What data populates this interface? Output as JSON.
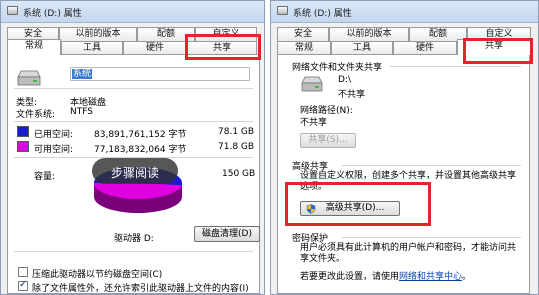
{
  "left_window": {
    "title": "系统 (D:) 属性",
    "tabs_row1": [
      "安全",
      "以前的版本",
      "配额",
      "自定义"
    ],
    "tabs_row2": [
      "常规",
      "工具",
      "硬件",
      "共享"
    ],
    "volume_label": "系统",
    "type_label": "类型:",
    "type_value": "本地磁盘",
    "fs_label": "文件系统:",
    "fs_value": "NTFS",
    "used_label": "已用空间:",
    "used_bytes": "83,891,761,152 字节",
    "used_gb": "78.1 GB",
    "free_label": "可用空间:",
    "free_bytes": "77,183,832,064 字节",
    "free_gb": "71.8 GB",
    "capacity_label": "容量:",
    "capacity_gb": "150 GB",
    "drive_label": "驱动器 D:",
    "disk_cleanup_button": "磁盘清理(D)",
    "compress_checkbox": "压缩此驱动器以节约磁盘空间(C)",
    "index_checkbox": "除了文件属性外，还允许索引此驱动器上文件的内容(I)",
    "colors": {
      "used": "#1a1ad6",
      "free": "#e000e0"
    },
    "capacity": {
      "used_gb": 78.1,
      "free_gb": 71.8
    }
  },
  "overlay": {
    "read_mode_label": "步骤阅读"
  },
  "right_window": {
    "title": "系统 (D:) 属性",
    "tabs_row1": [
      "安全",
      "以前的版本",
      "配额",
      "自定义"
    ],
    "tabs_row2": [
      "常规",
      "工具",
      "硬件",
      "共享"
    ],
    "network_group_title": "网络文件和文件夹共享",
    "drive_name": "D:\\",
    "share_status": "不共享",
    "network_path_label": "网络路径(N):",
    "network_path_value": "不共享",
    "share_button": "共享(S)...",
    "advanced_group_title": "高级共享",
    "advanced_desc": "设置自定义权限，创建多个共享，并设置其他高级共享选项。",
    "advanced_button": "高级共享(D)...",
    "password_group_title": "密码保护",
    "password_desc": "用户必须具有此计算机的用户帐户和密码，才能访问共享文件夹。",
    "password_change_prefix": "若要更改此设置，请使用",
    "network_center_link": "网络和共享中心",
    "period": "。"
  }
}
